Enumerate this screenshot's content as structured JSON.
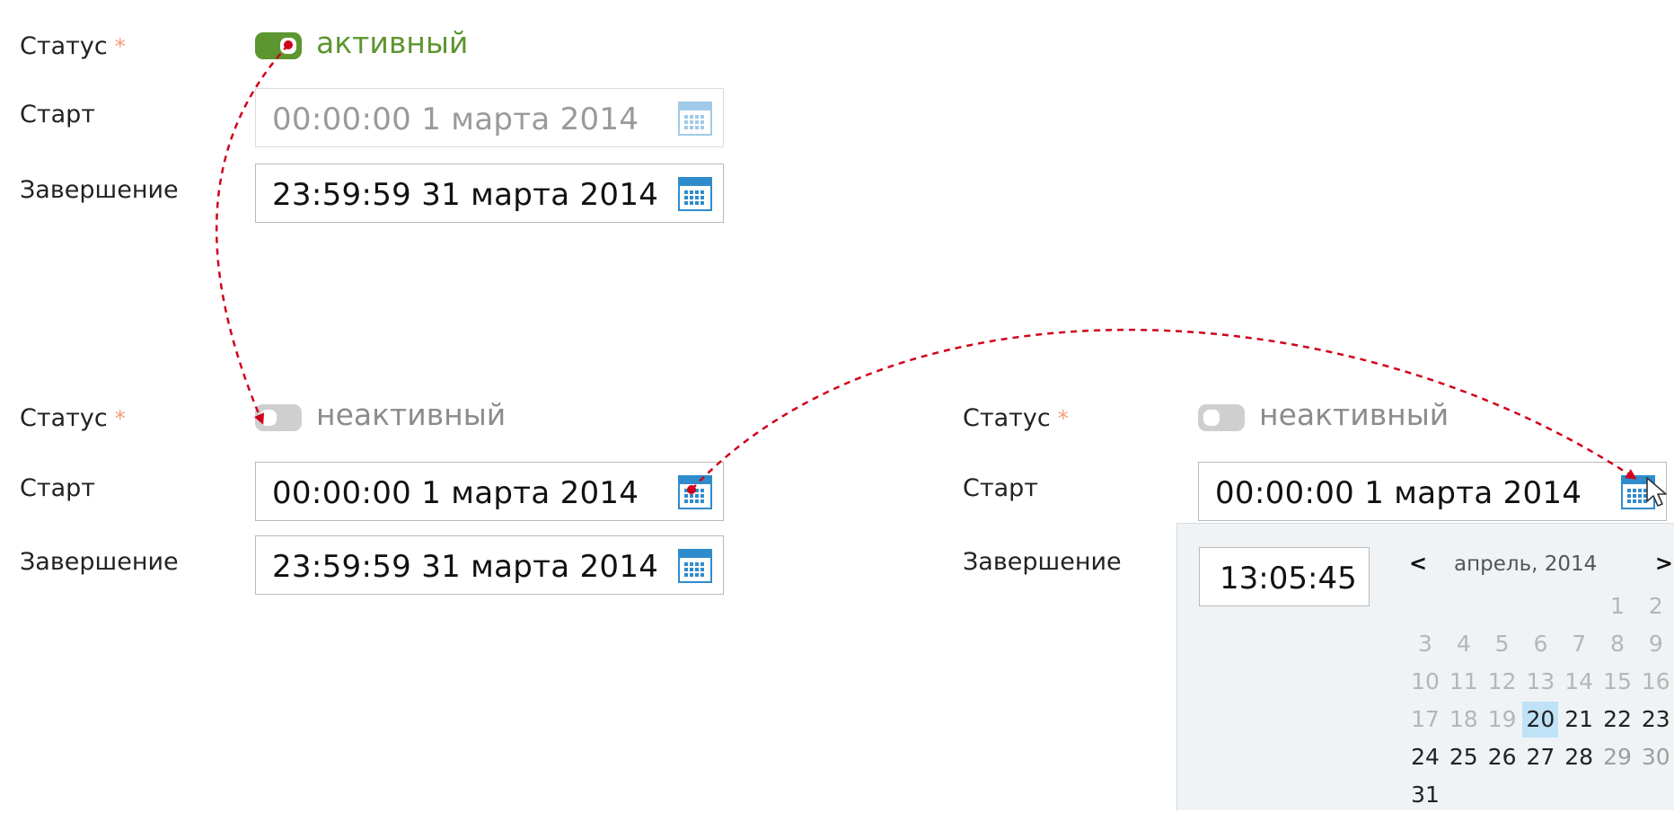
{
  "form1": {
    "status_label": "Статус",
    "required_mark": "*",
    "status_text": "активный",
    "start_label": "Старт",
    "start_value": "00:00:00  1 марта 2014",
    "end_label": "Завершение",
    "end_value": "23:59:59  31 марта 2014"
  },
  "form2": {
    "status_label": "Статус",
    "required_mark": "*",
    "status_text": "неактивный",
    "start_label": "Старт",
    "start_value": "00:00:00  1 марта 2014",
    "end_label": "Завершение",
    "end_value": "23:59:59  31 марта 2014"
  },
  "form3": {
    "status_label": "Статус",
    "required_mark": "*",
    "status_text": "неактивный",
    "start_label": "Старт",
    "start_value": "00:00:00  1 марта 2014",
    "end_label": "Завершение"
  },
  "picker": {
    "time_value": "13:05:45",
    "prev_label": "<",
    "next_label": ">",
    "month_title": "апрель, 2014",
    "days": [
      {
        "n": "1",
        "s": "muted"
      },
      {
        "n": "2",
        "s": "muted"
      },
      {
        "n": "3",
        "s": "muted"
      },
      {
        "n": "4",
        "s": "muted"
      },
      {
        "n": "5",
        "s": "muted"
      },
      {
        "n": "6",
        "s": "muted"
      },
      {
        "n": "7",
        "s": "muted"
      },
      {
        "n": "8",
        "s": "muted"
      },
      {
        "n": "9",
        "s": "muted"
      },
      {
        "n": "10",
        "s": "muted"
      },
      {
        "n": "11",
        "s": "muted"
      },
      {
        "n": "12",
        "s": "muted"
      },
      {
        "n": "13",
        "s": "muted"
      },
      {
        "n": "14",
        "s": "muted"
      },
      {
        "n": "15",
        "s": "muted"
      },
      {
        "n": "16",
        "s": "muted"
      },
      {
        "n": "17",
        "s": "muted"
      },
      {
        "n": "18",
        "s": "muted"
      },
      {
        "n": "19",
        "s": "muted"
      },
      {
        "n": "20",
        "s": "today"
      },
      {
        "n": "21",
        "s": "normal"
      },
      {
        "n": "22",
        "s": "normal"
      },
      {
        "n": "23",
        "s": "normal"
      },
      {
        "n": "24",
        "s": "normal"
      },
      {
        "n": "25",
        "s": "normal"
      },
      {
        "n": "26",
        "s": "normal"
      },
      {
        "n": "27",
        "s": "normal"
      },
      {
        "n": "28",
        "s": "normal"
      },
      {
        "n": "29",
        "s": "weekend"
      },
      {
        "n": "30",
        "s": "weekend"
      },
      {
        "n": "31",
        "s": "normal"
      }
    ]
  },
  "colors": {
    "active_green": "#5d9631",
    "required_star": "#f39b7a",
    "calendar_blue": "#2f8ccc",
    "arrow_red": "#d0021b",
    "today_highlight": "#bfe2f6"
  }
}
